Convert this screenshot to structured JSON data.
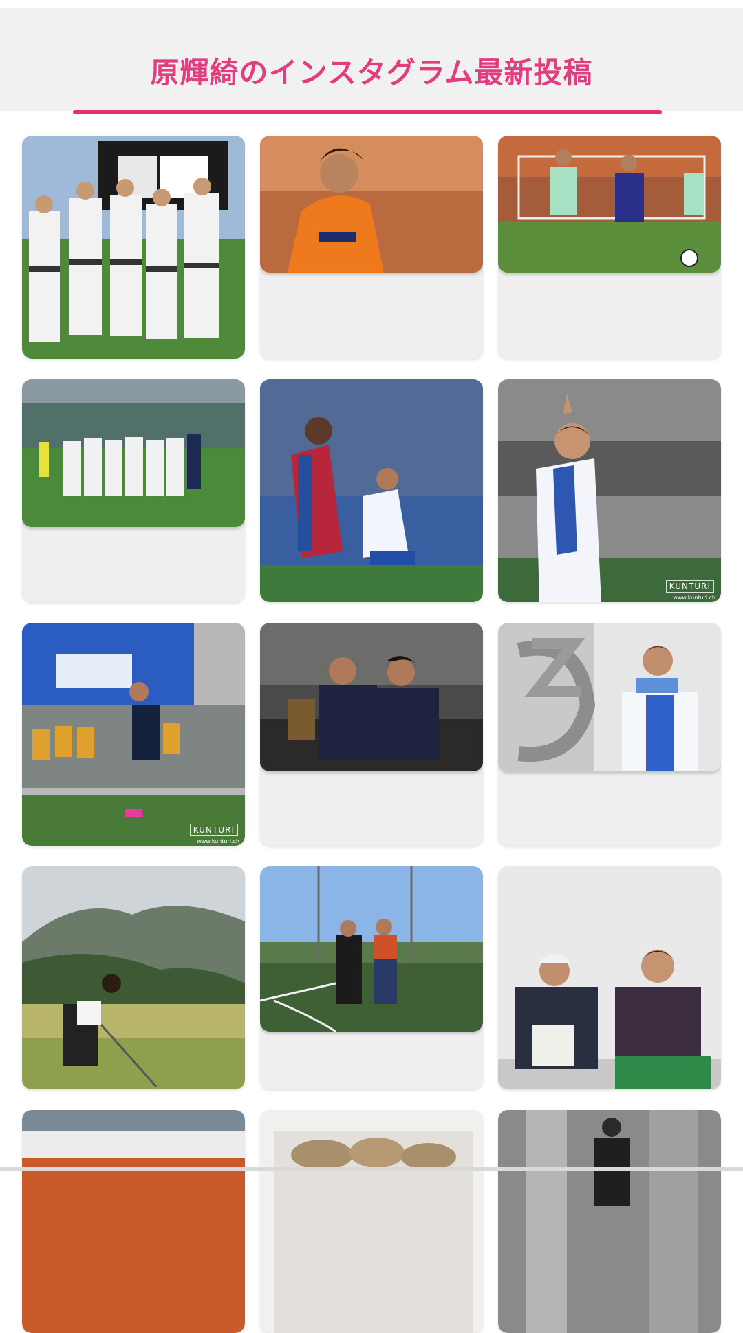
{
  "header": {
    "title": "原輝綺のインスタグラム最新投稿"
  },
  "colors": {
    "accent": "#e13d7f",
    "underline": "#e22f72",
    "card_bg": "#efefef"
  },
  "posts": [
    {
      "alt": "チーム写真 NEXT HOME GAME スコアボード前"
    },
    {
      "alt": "オレンジユニフォームの選手"
    },
    {
      "alt": "試合中のドリブル"
    },
    {
      "alt": "スタジアムでのチーム集合写真"
    },
    {
      "alt": "試合中の選手たち"
    },
    {
      "alt": "青白ユニフォームで指示を出す選手",
      "watermark": "KUNTURI",
      "watermark_url": "www.kunturi.ch"
    },
    {
      "alt": "ピッチを走る選手",
      "watermark": "KUNTURI",
      "watermark_url": "www.kunturi.ch"
    },
    {
      "alt": "ベンチに座る二人の選手"
    },
    {
      "alt": "ユニフォームを持つ選手"
    },
    {
      "alt": "ゴルフ場でスイングする人"
    },
    {
      "alt": "グラウンドに立つ二人"
    },
    {
      "alt": "ピースサインをする二人"
    },
    {
      "alt": "スタジアム"
    },
    {
      "alt": "食べ物"
    },
    {
      "alt": "室内の人物"
    }
  ]
}
